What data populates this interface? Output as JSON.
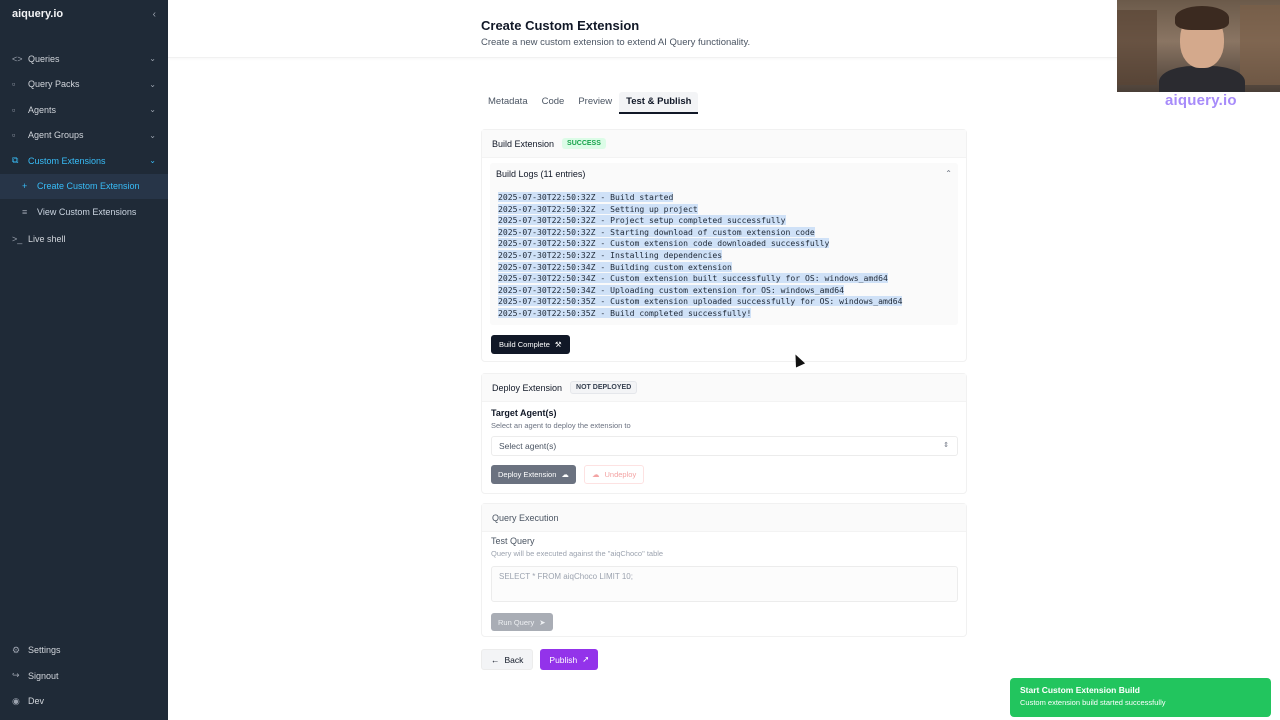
{
  "sidebar": {
    "brand": "aiquery.io",
    "collapse_icon": "chevron-left-icon",
    "items": [
      {
        "label": "Queries",
        "icon": "code-icon"
      },
      {
        "label": "Query Packs",
        "icon": "folder-icon"
      },
      {
        "label": "Agents",
        "icon": "folder-icon"
      },
      {
        "label": "Agent Groups",
        "icon": "folder-icon"
      },
      {
        "label": "Custom Extensions",
        "icon": "extension-icon"
      }
    ],
    "sub_items": [
      {
        "label": "Create Custom Extension",
        "icon": "plus-icon"
      },
      {
        "label": "View Custom Extensions",
        "icon": "list-icon"
      }
    ],
    "live_shell": "Live shell",
    "bottom": [
      {
        "label": "Settings",
        "icon": "gear-icon"
      },
      {
        "label": "Signout",
        "icon": "signout-icon"
      },
      {
        "label": "Dev",
        "icon": "dev-icon"
      }
    ]
  },
  "header": {
    "title": "Create Custom Extension",
    "subtitle": "Create a new custom extension to extend AI Query functionality."
  },
  "tabs": [
    "Metadata",
    "Code",
    "Preview",
    "Test & Publish"
  ],
  "build": {
    "title": "Build Extension",
    "status": "SUCCESS",
    "logs_title": "Build Logs (11 entries)",
    "logs": [
      "2025-07-30T22:50:32Z - Build started",
      "2025-07-30T22:50:32Z - Setting up project",
      "2025-07-30T22:50:32Z - Project setup completed successfully",
      "2025-07-30T22:50:32Z - Starting download of custom extension code",
      "2025-07-30T22:50:32Z - Custom extension code downloaded successfully",
      "2025-07-30T22:50:32Z - Installing dependencies",
      "2025-07-30T22:50:34Z - Building custom extension",
      "2025-07-30T22:50:34Z - Custom extension built successfully for OS: windows_amd64",
      "2025-07-30T22:50:34Z - Uploading custom extension for OS: windows_amd64",
      "2025-07-30T22:50:35Z - Custom extension uploaded successfully for OS: windows_amd64",
      "2025-07-30T22:50:35Z - Build completed successfully!"
    ],
    "button": "Build Complete"
  },
  "deploy": {
    "title": "Deploy Extension",
    "status": "NOT DEPLOYED",
    "target_label": "Target Agent(s)",
    "target_help": "Select an agent to deploy the extension to",
    "select_placeholder": "Select agent(s)",
    "deploy_button": "Deploy Extension",
    "undeploy_button": "Undeploy"
  },
  "query": {
    "title": "Query Execution",
    "test_label": "Test Query",
    "test_help": "Query will be executed against the \"aiqChoco\" table",
    "placeholder": "SELECT * FROM aiqChoco LIMIT 10;",
    "run_button": "Run Query"
  },
  "footer": {
    "back": "Back",
    "publish": "Publish"
  },
  "webcam": {
    "brand": "aiquery.io"
  },
  "toast": {
    "title": "Start Custom Extension Build",
    "description": "Custom extension build started successfully"
  },
  "colors": {
    "sidebar_bg": "#1f2a37",
    "accent": "#38bdf8",
    "publish": "#9333ea",
    "toast": "#22c55e"
  }
}
